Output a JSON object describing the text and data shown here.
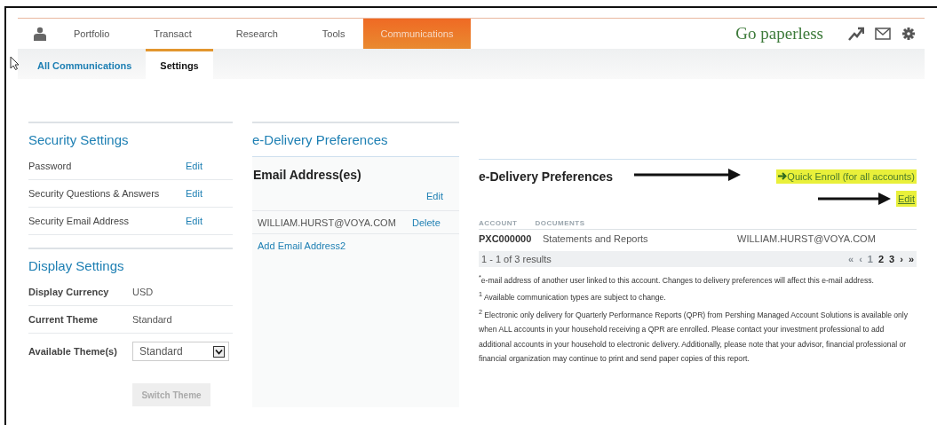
{
  "nav": {
    "items": [
      {
        "label": "Portfolio",
        "selected": false
      },
      {
        "label": "Transact",
        "selected": false
      },
      {
        "label": "Research",
        "selected": false
      },
      {
        "label": "Tools",
        "selected": false
      },
      {
        "label": "Communications",
        "selected": true
      }
    ],
    "promo": "Go paperless"
  },
  "subnav": [
    {
      "label": "All Communications",
      "selected": false
    },
    {
      "label": "Settings",
      "selected": true
    }
  ],
  "security_settings": {
    "title": "Security Settings",
    "rows": [
      {
        "label": "Password",
        "action": "Edit"
      },
      {
        "label": "Security Questions & Answers",
        "action": "Edit"
      },
      {
        "label": "Security Email Address",
        "action": "Edit"
      }
    ]
  },
  "display_settings": {
    "title": "Display Settings",
    "rows": [
      {
        "kind": "text",
        "label": "Display Currency",
        "value": "USD"
      },
      {
        "kind": "text",
        "label": "Current Theme",
        "value": "Standard"
      },
      {
        "kind": "select",
        "label": "Available Theme(s)",
        "value": "Standard"
      }
    ],
    "button": "Switch Theme"
  },
  "edelivery": {
    "title": "e-Delivery Preferences",
    "email_panel": {
      "title": "Email Address(es)",
      "edit": "Edit",
      "emails": [
        {
          "address": "WILLIAM.HURST@VOYA.COM",
          "action": "Delete"
        }
      ],
      "add": "Add Email Address2"
    },
    "prefs_panel": {
      "title": "e-Delivery Preferences",
      "quick_enroll": {
        "label": "Quick Enroll (for all accounts)",
        "highlighted": true
      },
      "edit": {
        "label": "Edit",
        "highlighted": true
      },
      "columns": [
        "ACCOUNT",
        "DOCUMENTS"
      ],
      "rows": [
        {
          "account": "PXC000000",
          "documents": "Statements and Reports",
          "email": "WILLIAM.HURST@VOYA.COM"
        }
      ],
      "results": "1 - 1 of 3 results",
      "pages": [
        {
          "label": "«",
          "disabled": true
        },
        {
          "label": "‹",
          "disabled": true
        },
        {
          "label": "1",
          "disabled": true
        },
        {
          "label": "2",
          "disabled": false
        },
        {
          "label": "3",
          "disabled": false
        },
        {
          "label": "›",
          "disabled": false
        },
        {
          "label": "»",
          "disabled": false
        }
      ],
      "footnotes": [
        "$^{*}$e-mail address of another user linked to this account. Changes to delivery preferences will affect this e-mail address.",
        "$^{1}$ Available communication types are subject to change.",
        "$^{2}$ Electronic only delivery for Quarterly Performance Reports (QPR) from Pershing Managed Account Solutions is available only when ALL accounts in your household receiving a QPR are enrolled. Please contact your investment professional to add additional accounts in your household to electronic delivery. Additionally, please note that your advisor, financial professional or financial organization may continue to print and send paper copies of this report."
      ]
    }
  }
}
